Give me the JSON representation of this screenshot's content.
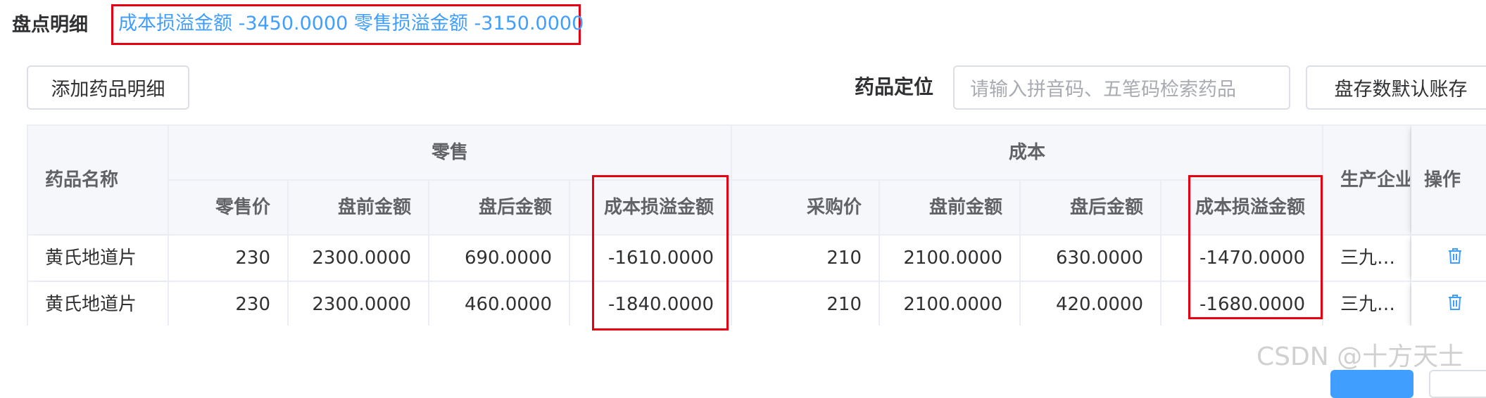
{
  "header": {
    "title": "盘点明细",
    "summary": "成本损溢金额 -3450.0000 零售损溢金额 -3150.0000"
  },
  "toolbar": {
    "add_button": "添加药品明细",
    "locate_label": "药品定位",
    "search_placeholder": "请输入拼音码、五笔码检索药品",
    "default_button": "盘存数默认账存"
  },
  "table": {
    "col_name": "药品名称",
    "group_retail": "零售",
    "group_cost": "成本",
    "col_retail_price": "零售价",
    "col_before_amount": "盘前金额",
    "col_after_amount": "盘后金额",
    "col_profit_loss": "成本损溢金额",
    "col_purchase_price": "采购价",
    "col_manufacturer": "生产企业",
    "col_action": "操作",
    "rows": [
      {
        "name": "黄氏地道片",
        "retail_price": "230",
        "retail_before": "2300.0000",
        "retail_after": "690.0000",
        "retail_pl": "-1610.0000",
        "purchase_price": "210",
        "cost_before": "2100.0000",
        "cost_after": "630.0000",
        "cost_pl": "-1470.0000",
        "manufacturer": "三九…"
      },
      {
        "name": "黄氏地道片",
        "retail_price": "230",
        "retail_before": "2300.0000",
        "retail_after": "460.0000",
        "retail_pl": "-1840.0000",
        "purchase_price": "210",
        "cost_before": "2100.0000",
        "cost_after": "420.0000",
        "cost_pl": "-1680.0000",
        "manufacturer": "三九…"
      }
    ]
  },
  "watermark": "CSDN @十方天士",
  "icons": {
    "delete": "trash-icon"
  },
  "colors": {
    "accent": "#409eff",
    "highlight": "#e60012",
    "header_bg": "#f5f7fa"
  }
}
